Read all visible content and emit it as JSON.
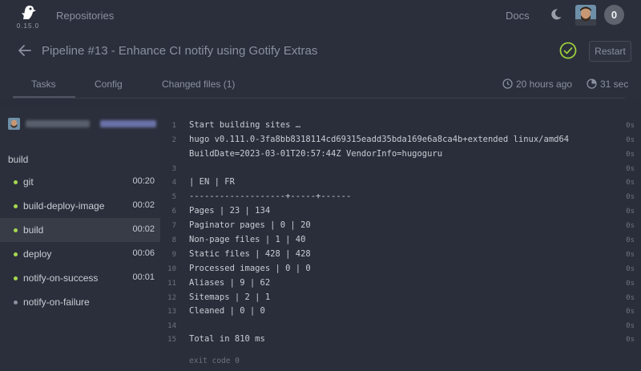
{
  "topbar": {
    "logo_icon": "woodpecker-logo-icon",
    "version": "0.15.0",
    "repositories_label": "Repositories",
    "docs_label": "Docs",
    "theme_icon": "moon-icon",
    "notifications_count": "0"
  },
  "pipeline": {
    "title": "Pipeline #13  -  Enhance CI notify using Gotify Extras",
    "status": "success",
    "restart_label": "Restart",
    "tabs": [
      {
        "label": "Tasks"
      },
      {
        "label": "Config"
      },
      {
        "label": "Changed files (1)"
      }
    ],
    "created": "20 hours ago",
    "duration": "31 sec"
  },
  "workflow": {
    "name": "build",
    "steps": [
      {
        "name": "git",
        "duration": "00:20",
        "status": "success"
      },
      {
        "name": "build-deploy-image",
        "duration": "00:02",
        "status": "success"
      },
      {
        "name": "build",
        "duration": "00:02",
        "status": "success"
      },
      {
        "name": "deploy",
        "duration": "00:06",
        "status": "success"
      },
      {
        "name": "notify-on-success",
        "duration": "00:01",
        "status": "success"
      },
      {
        "name": "notify-on-failure",
        "duration": "",
        "status": "skipped"
      }
    ]
  },
  "log": {
    "lines": [
      {
        "n": "1",
        "text": "Start building sites … ",
        "time": "0s"
      },
      {
        "n": "2",
        "text": "hugo v0.111.0-3fa8bb8318114cd69315eadd35bda169e6a8ca4b+extended linux/amd64",
        "time": "0s"
      },
      {
        "n": "",
        "text": "BuildDate=2023-03-01T20:57:44Z VendorInfo=hugoguru",
        "time": "0s"
      },
      {
        "n": "3",
        "text": "",
        "time": "0s"
      },
      {
        "n": "4",
        "text": "| EN | FR",
        "time": "0s"
      },
      {
        "n": "5",
        "text": "-------------------+-----+------",
        "time": "0s"
      },
      {
        "n": "6",
        "text": "Pages | 23 | 134",
        "time": "0s"
      },
      {
        "n": "7",
        "text": "Paginator pages | 0 | 20",
        "time": "0s"
      },
      {
        "n": "8",
        "text": "Non-page files | 1 | 40",
        "time": "0s"
      },
      {
        "n": "9",
        "text": "Static files | 428 | 428",
        "time": "0s"
      },
      {
        "n": "10",
        "text": "Processed images | 0 | 0",
        "time": "0s"
      },
      {
        "n": "11",
        "text": "Aliases | 9 | 62",
        "time": "0s"
      },
      {
        "n": "12",
        "text": "Sitemaps | 2 | 1",
        "time": "0s"
      },
      {
        "n": "13",
        "text": "Cleaned | 0 | 0",
        "time": "0s"
      },
      {
        "n": "14",
        "text": "",
        "time": "0s"
      },
      {
        "n": "15",
        "text": "Total in 810 ms",
        "time": "0s"
      }
    ],
    "exit": "exit code 0"
  },
  "colors": {
    "success": "#a6d94f",
    "skipped": "#8a90a0",
    "status_ok": "#9ccc3c"
  }
}
